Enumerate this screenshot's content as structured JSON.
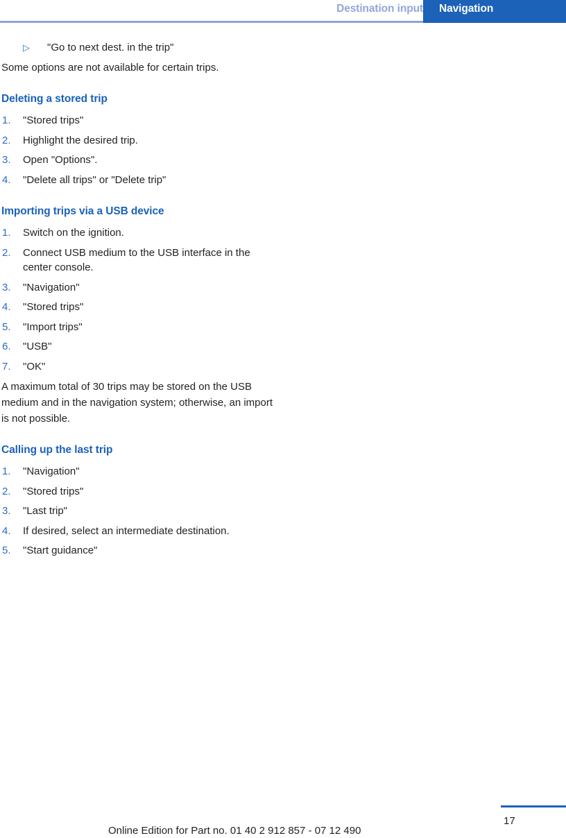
{
  "header": {
    "inactive_tab": "Destination input",
    "active_tab": "Navigation",
    "accent_blue": "#1b62b8",
    "muted_blue": "#90a7da",
    "rule_blue": "#8ba4d8"
  },
  "content": {
    "bullet": {
      "glyph": "▷",
      "text": "\"Go to next dest. in the trip\""
    },
    "intro_paragraph": "Some options are not available for certain trips.",
    "sections": [
      {
        "title": "Deleting a stored trip",
        "steps": [
          "\"Stored trips\"",
          "Highlight the desired trip.",
          "Open \"Options\".",
          "\"Delete all trips\" or \"Delete trip\""
        ]
      },
      {
        "title": "Importing trips via a USB device",
        "steps": [
          "Switch on the ignition.",
          "Connect USB medium to the USB interface in the center console.",
          "\"Navigation\"",
          "\"Stored trips\"",
          "\"Import trips\"",
          "\"USB\"",
          "\"OK\""
        ],
        "note": "A maximum total of 30 trips may be stored on the USB medium and in the navigation system; otherwise, an import is not possible."
      },
      {
        "title": "Calling up the last trip",
        "steps": [
          "\"Navigation\"",
          "\"Stored trips\"",
          "\"Last trip\"",
          "If desired, select an intermediate destination.",
          "\"Start guidance\""
        ]
      }
    ]
  },
  "footer": {
    "page_number": "17",
    "edition_note": "Online Edition for Part no. 01 40 2 912 857 - 07 12 490"
  }
}
